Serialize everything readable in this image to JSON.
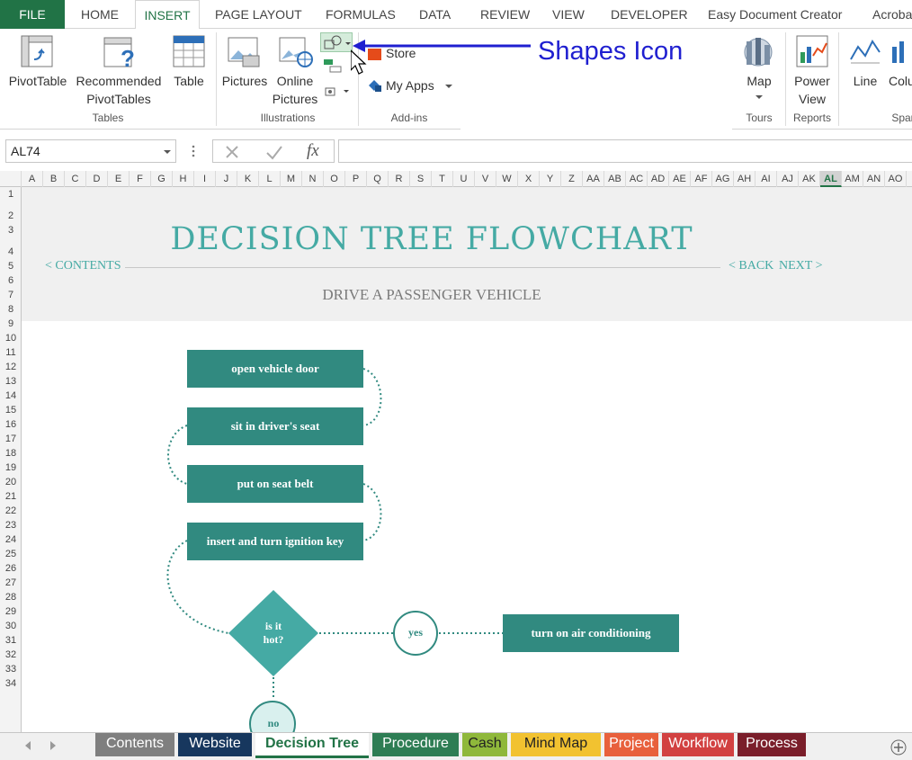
{
  "ribbon_tabs": [
    "FILE",
    "HOME",
    "INSERT",
    "PAGE LAYOUT",
    "FORMULAS",
    "DATA",
    "REVIEW",
    "VIEW",
    "DEVELOPER",
    "Easy Document Creator",
    "Acroba"
  ],
  "ribbon": {
    "tables": {
      "pivot": "PivotTable",
      "recommended": "Recommended PivotTables",
      "table": "Table",
      "label": "Tables"
    },
    "illustrations": {
      "pictures": "Pictures",
      "online": "Online Pictures",
      "label": "Illustrations"
    },
    "addins": {
      "store": "Store",
      "myapps": "My Apps",
      "label": "Add-ins"
    },
    "tours": {
      "map": "Map",
      "label": "Tours"
    },
    "reports": {
      "power": "Power View",
      "label": "Reports"
    },
    "spark": {
      "line": "Line",
      "column": "Colu",
      "label": "Spar"
    }
  },
  "annotation": "Shapes Icon",
  "formula_bar": {
    "name_box": "AL74",
    "fx": "fx",
    "formula": ""
  },
  "columns": [
    "A",
    "B",
    "C",
    "D",
    "E",
    "F",
    "G",
    "H",
    "I",
    "J",
    "K",
    "L",
    "M",
    "N",
    "O",
    "P",
    "Q",
    "R",
    "S",
    "T",
    "U",
    "V",
    "W",
    "X",
    "Y",
    "Z",
    "AA",
    "AB",
    "AC",
    "AD",
    "AE",
    "AF",
    "AG",
    "AH",
    "AI",
    "AJ",
    "AK",
    "AL",
    "AM",
    "AN",
    "AO"
  ],
  "selected_column": "AL",
  "rows": [
    "1",
    "2",
    "3",
    "4",
    "5",
    "6",
    "7",
    "8",
    "9",
    "10",
    "11",
    "12",
    "13",
    "14",
    "15",
    "16",
    "17",
    "18",
    "19",
    "20",
    "21",
    "22",
    "23",
    "24",
    "25",
    "26",
    "27",
    "28",
    "29",
    "30",
    "31",
    "32",
    "33",
    "34"
  ],
  "sheet": {
    "title": "DECISION TREE FLOWCHART",
    "contents_link": "< CONTENTS",
    "back_link": "< BACK",
    "next_link": "NEXT >",
    "subtitle": "DRIVE A PASSENGER VEHICLE",
    "steps": [
      "open vehicle door",
      "sit in driver's seat",
      "put on seat belt",
      "insert and turn ignition key"
    ],
    "decision": "is it hot?",
    "yes_label": "yes",
    "no_label": "no",
    "yes_action": "turn on air conditioning",
    "accent_color": "#318a80",
    "light_accent": "#45aaa4"
  },
  "sheet_tabs": [
    {
      "label": "Contents",
      "color": "#7f7f7f"
    },
    {
      "label": "Website",
      "color": "#17375e"
    },
    {
      "label": "Decision Tree",
      "color": "#ffffff",
      "active": true
    },
    {
      "label": "Procedure",
      "color": "#2e7d54"
    },
    {
      "label": "Cash",
      "color": "#8fb83b"
    },
    {
      "label": "Mind Map",
      "color": "#f2c230"
    },
    {
      "label": "Project",
      "color": "#e8603c"
    },
    {
      "label": "Workflow",
      "color": "#d24141"
    },
    {
      "label": "Process",
      "color": "#7a1e2a"
    }
  ]
}
